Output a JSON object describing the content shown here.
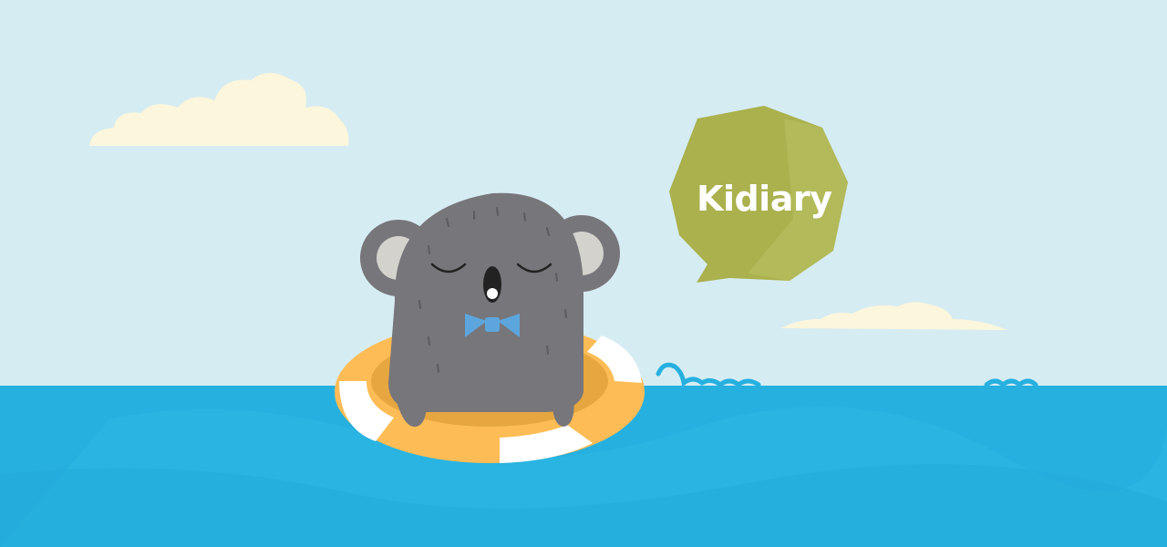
{
  "speech_bubble": {
    "label": "Kidiary"
  },
  "colors": {
    "sky": "#d6ecf3",
    "sea": "#26b0e0",
    "cloud": "#fbf6dc",
    "koala_fur": "#77767b",
    "koala_ear_inner": "#d3d2cc",
    "bow_tie": "#5ca6dd",
    "float_ring_orange": "#fdbc55",
    "float_ring_white": "#ffffff",
    "bubble": "#aab14d"
  },
  "icons": [
    "cloud-icon",
    "koala-icon",
    "bow-tie-icon",
    "float-ring-icon",
    "speech-bubble-icon",
    "wave-icon"
  ]
}
